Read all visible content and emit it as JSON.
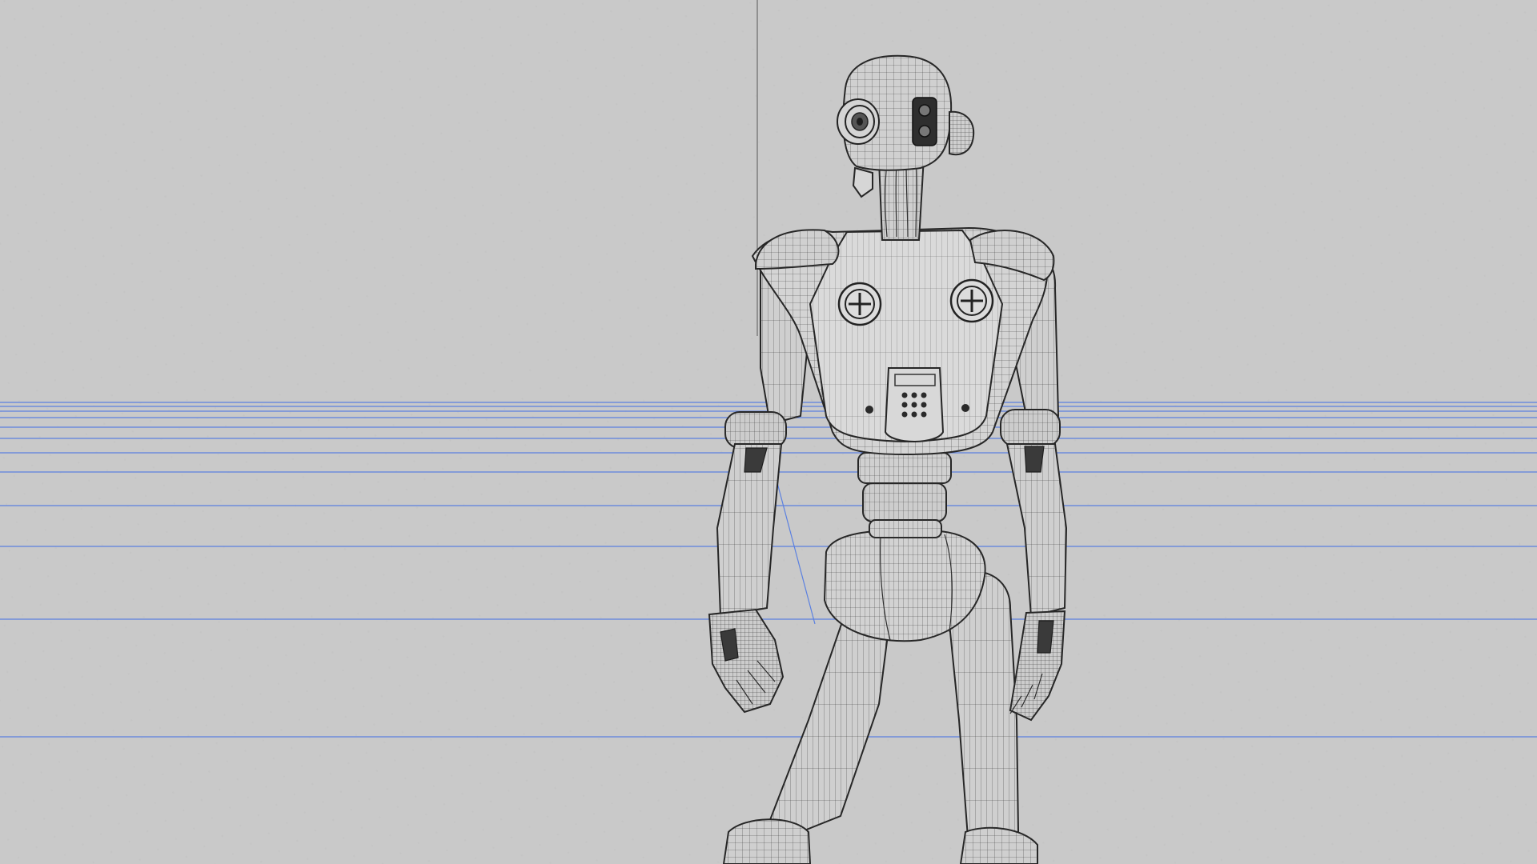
{
  "scene": {
    "background": "#c9c9c9",
    "grid_line_color": "#5b80e0",
    "wire_color": "#2e2e2e",
    "surface_color": "#d0d0d0",
    "subject": "wireframe-robot-rear-view"
  }
}
